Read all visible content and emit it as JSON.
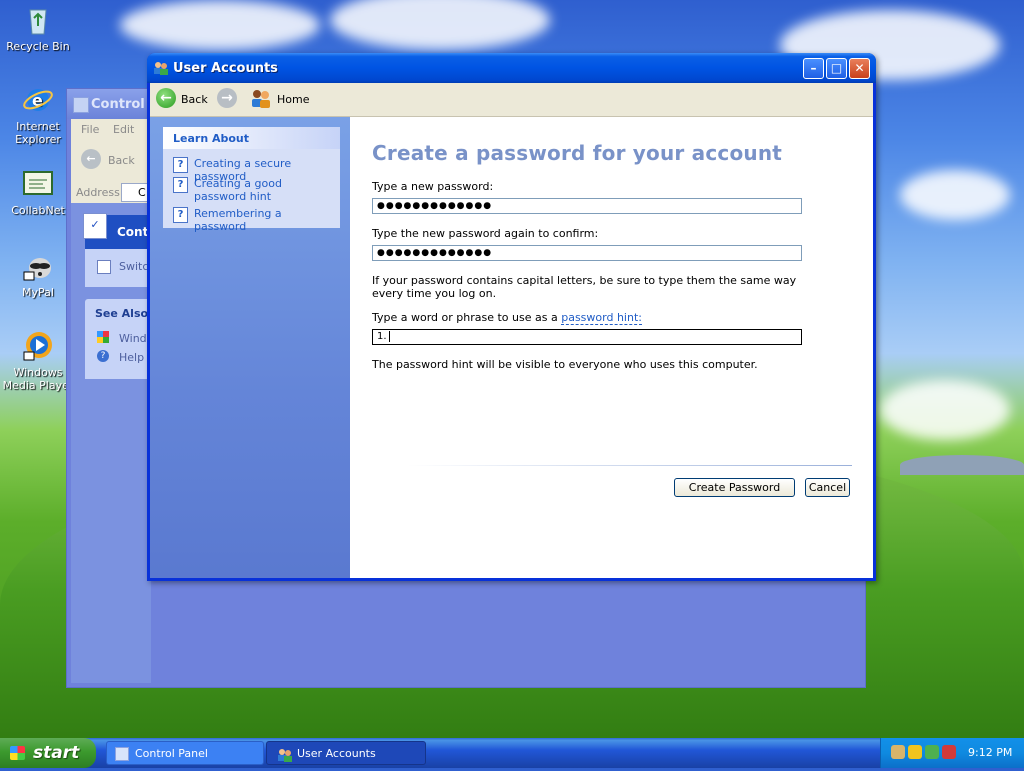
{
  "desktop": {
    "icons": [
      {
        "name": "Recycle Bin"
      },
      {
        "name": "Internet Explorer"
      },
      {
        "name": "CollabNet"
      },
      {
        "name": "MyPal"
      },
      {
        "name": "Windows Media Player"
      }
    ]
  },
  "control_panel": {
    "title": "Control Panel",
    "menu": [
      "File",
      "Edit"
    ],
    "back_label": "Back",
    "address_label": "Address",
    "address_value": "C",
    "panel_title": "Contro",
    "switch_label": "Switch",
    "see_also_title": "See Also",
    "see_also_items": [
      "Windo",
      "Help a"
    ]
  },
  "window": {
    "title": "User Accounts",
    "nav": {
      "back_label": "Back",
      "home_label": "Home"
    },
    "learn_about": {
      "title": "Learn About",
      "links": [
        "Creating a secure password",
        "Creating a good password hint",
        "Remembering a password"
      ]
    },
    "heading": "Create a password for your account",
    "new_password_label": "Type a new password:",
    "new_password_value": "●●●●●●●●●●●●●",
    "confirm_label": "Type the new password again to confirm:",
    "confirm_value": "●●●●●●●●●●●●●",
    "caps_note": "If your password contains capital letters, be sure to type them the same way every time you log on.",
    "hint_label_prefix": "Type a word or phrase to use as a ",
    "hint_link": "password hint:",
    "hint_value": "1.",
    "hint_note": "The password hint will be visible to everyone who uses this computer.",
    "create_button": "Create Password",
    "cancel_button": "Cancel"
  },
  "taskbar": {
    "start_label": "start",
    "items": [
      "Control Panel",
      "User Accounts"
    ],
    "clock": "9:12 PM"
  },
  "colors": {
    "title_blue": "#0054e3",
    "heading": "#7992c8",
    "link": "#215dc6",
    "start_green": "#3c9a2e"
  }
}
